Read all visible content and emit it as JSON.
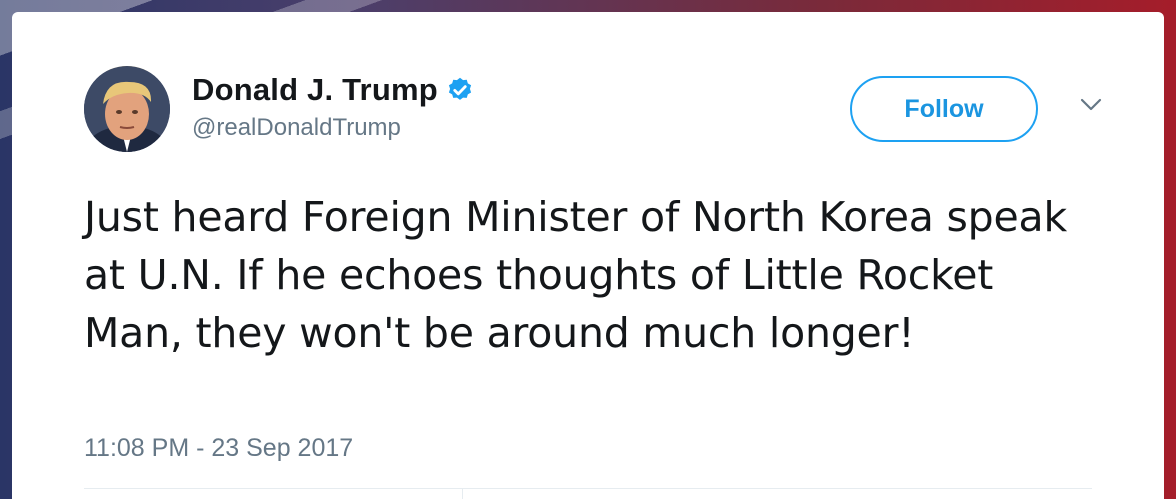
{
  "user": {
    "display_name": "Donald J. Trump",
    "handle": "@realDonaldTrump",
    "verified": true
  },
  "actions": {
    "follow_label": "Follow"
  },
  "tweet": {
    "text": "Just heard Foreign Minister of North Korea speak at U.N. If he echoes thoughts of Little Rocket Man, they won't be around much longer!",
    "timestamp": "11:08 PM - 23 Sep 2017"
  },
  "colors": {
    "accent": "#1da1f2",
    "text": "#14171a",
    "secondary": "#657786"
  },
  "icons": {
    "verified": "verified-badge-icon",
    "caret": "chevron-down-icon"
  }
}
